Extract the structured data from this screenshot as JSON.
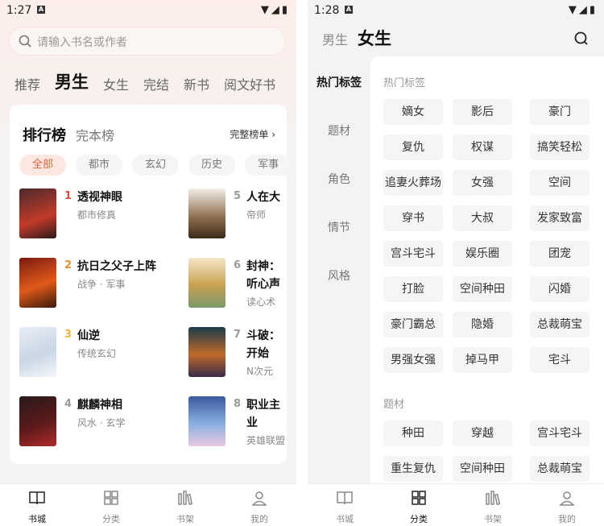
{
  "left": {
    "status": {
      "time": "1:27"
    },
    "search": {
      "placeholder": "请输入书名或作者"
    },
    "tabs": [
      "推荐",
      "男生",
      "女生",
      "完结",
      "新书",
      "阅文好书"
    ],
    "ranking": {
      "title": "排行榜",
      "title2": "完本榜",
      "more": "完整榜单 ›",
      "chips": [
        "全部",
        "都市",
        "玄幻",
        "历史",
        "军事"
      ],
      "books": [
        {
          "rank": "1",
          "title": "透视神眼",
          "sub": "都市修真",
          "color": "#e8453c"
        },
        {
          "rank": "2",
          "title": "抗日之父子上阵",
          "sub": "战争 · 军事",
          "color": "#f08a2c"
        },
        {
          "rank": "3",
          "title": "仙逆",
          "sub": "传统玄幻",
          "color": "#f5b931"
        },
        {
          "rank": "4",
          "title": "麒麟神相",
          "sub": "风水 · 玄学",
          "color": "#999999"
        },
        {
          "rank": "5",
          "title": "人在大",
          "sub": "帝师",
          "color": "#999999"
        },
        {
          "rank": "6",
          "title": "封神：",
          "title2": "听心声",
          "sub": "读心术",
          "color": "#999999"
        },
        {
          "rank": "7",
          "title": "斗破：",
          "title2": "开始",
          "sub": "N次元",
          "color": "#999999"
        },
        {
          "rank": "8",
          "title": "职业主",
          "title2": "业",
          "sub": "英雄联盟",
          "color": "#999999"
        }
      ]
    },
    "nav": [
      "书城",
      "分类",
      "书架",
      "我的"
    ]
  },
  "right": {
    "status": {
      "time": "1:28"
    },
    "header": {
      "male": "男生",
      "female": "女生"
    },
    "sidebar": [
      "热门标签",
      "题材",
      "角色",
      "情节",
      "风格"
    ],
    "section1": {
      "title": "热门标签",
      "tags": [
        "嫡女",
        "影后",
        "豪门",
        "复仇",
        "权谋",
        "搞笑轻松",
        "追妻火葬场",
        "女强",
        "空间",
        "穿书",
        "大叔",
        "发家致富",
        "宫斗宅斗",
        "娱乐圈",
        "团宠",
        "打脸",
        "空间种田",
        "闪婚",
        "豪门霸总",
        "隐婚",
        "总裁萌宝",
        "男强女强",
        "掉马甲",
        "宅斗"
      ]
    },
    "section2": {
      "title": "题材",
      "tags": [
        "种田",
        "穿越",
        "宫斗宅斗",
        "重生复仇",
        "空间种田",
        "总裁萌宝"
      ]
    },
    "nav": [
      "书城",
      "分类",
      "书架",
      "我的"
    ]
  },
  "colors": {
    "accent": "#e8603a",
    "chip_bg": "#fde7e1"
  },
  "icons": [
    "search-icon",
    "wifi-icon",
    "signal-icon",
    "battery-icon",
    "book-icon",
    "grid-icon",
    "shelf-icon",
    "user-icon"
  ]
}
